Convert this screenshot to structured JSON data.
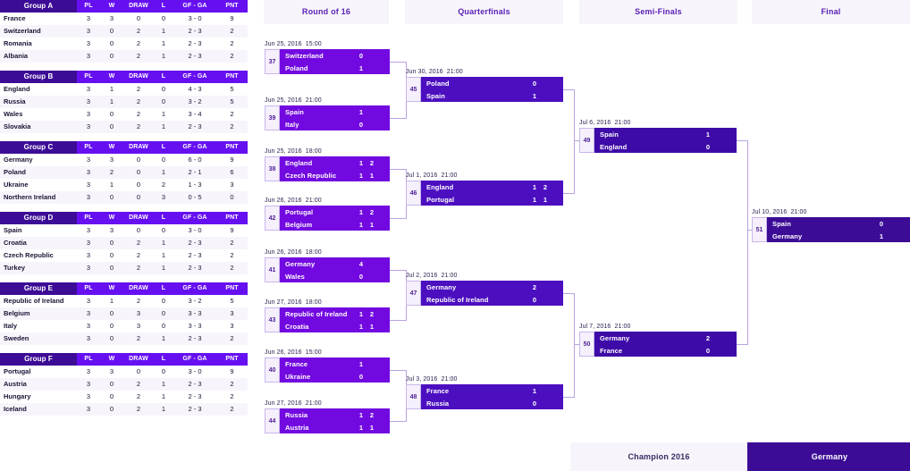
{
  "groups": {
    "columns": [
      "PL",
      "W",
      "DRAW",
      "L",
      "GF - GA",
      "PNT"
    ],
    "tables": [
      {
        "name": "Group A",
        "rows": [
          {
            "team": "France",
            "pl": "3",
            "w": "3",
            "draw": "0",
            "l": "0",
            "gfga": "3 - 0",
            "pnt": "9"
          },
          {
            "team": "Switzerland",
            "pl": "3",
            "w": "0",
            "draw": "2",
            "l": "1",
            "gfga": "2 - 3",
            "pnt": "2"
          },
          {
            "team": "Romania",
            "pl": "3",
            "w": "0",
            "draw": "2",
            "l": "1",
            "gfga": "2 - 3",
            "pnt": "2"
          },
          {
            "team": "Albania",
            "pl": "3",
            "w": "0",
            "draw": "2",
            "l": "1",
            "gfga": "2 - 3",
            "pnt": "2"
          }
        ]
      },
      {
        "name": "Group B",
        "rows": [
          {
            "team": "England",
            "pl": "3",
            "w": "1",
            "draw": "2",
            "l": "0",
            "gfga": "4 - 3",
            "pnt": "5"
          },
          {
            "team": "Russia",
            "pl": "3",
            "w": "1",
            "draw": "2",
            "l": "0",
            "gfga": "3 - 2",
            "pnt": "5"
          },
          {
            "team": "Wales",
            "pl": "3",
            "w": "0",
            "draw": "2",
            "l": "1",
            "gfga": "3 - 4",
            "pnt": "2"
          },
          {
            "team": "Slovakia",
            "pl": "3",
            "w": "0",
            "draw": "2",
            "l": "1",
            "gfga": "2 - 3",
            "pnt": "2"
          }
        ]
      },
      {
        "name": "Group C",
        "rows": [
          {
            "team": "Germany",
            "pl": "3",
            "w": "3",
            "draw": "0",
            "l": "0",
            "gfga": "6 - 0",
            "pnt": "9"
          },
          {
            "team": "Poland",
            "pl": "3",
            "w": "2",
            "draw": "0",
            "l": "1",
            "gfga": "2 - 1",
            "pnt": "6"
          },
          {
            "team": "Ukraine",
            "pl": "3",
            "w": "1",
            "draw": "0",
            "l": "2",
            "gfga": "1 - 3",
            "pnt": "3"
          },
          {
            "team": "Northern Ireland",
            "pl": "3",
            "w": "0",
            "draw": "0",
            "l": "3",
            "gfga": "0 - 5",
            "pnt": "0"
          }
        ]
      },
      {
        "name": "Group D",
        "rows": [
          {
            "team": "Spain",
            "pl": "3",
            "w": "3",
            "draw": "0",
            "l": "0",
            "gfga": "3 - 0",
            "pnt": "9"
          },
          {
            "team": "Croatia",
            "pl": "3",
            "w": "0",
            "draw": "2",
            "l": "1",
            "gfga": "2 - 3",
            "pnt": "2"
          },
          {
            "team": "Czech Republic",
            "pl": "3",
            "w": "0",
            "draw": "2",
            "l": "1",
            "gfga": "2 - 3",
            "pnt": "2"
          },
          {
            "team": "Turkey",
            "pl": "3",
            "w": "0",
            "draw": "2",
            "l": "1",
            "gfga": "2 - 3",
            "pnt": "2"
          }
        ]
      },
      {
        "name": "Group E",
        "rows": [
          {
            "team": "Republic of Ireland",
            "pl": "3",
            "w": "1",
            "draw": "2",
            "l": "0",
            "gfga": "3 - 2",
            "pnt": "5"
          },
          {
            "team": "Belgium",
            "pl": "3",
            "w": "0",
            "draw": "3",
            "l": "0",
            "gfga": "3 - 3",
            "pnt": "3"
          },
          {
            "team": "Italy",
            "pl": "3",
            "w": "0",
            "draw": "3",
            "l": "0",
            "gfga": "3 - 3",
            "pnt": "3"
          },
          {
            "team": "Sweden",
            "pl": "3",
            "w": "0",
            "draw": "2",
            "l": "1",
            "gfga": "2 - 3",
            "pnt": "2"
          }
        ]
      },
      {
        "name": "Group F",
        "rows": [
          {
            "team": "Portugal",
            "pl": "3",
            "w": "3",
            "draw": "0",
            "l": "0",
            "gfga": "3 - 0",
            "pnt": "9"
          },
          {
            "team": "Austria",
            "pl": "3",
            "w": "0",
            "draw": "2",
            "l": "1",
            "gfga": "2 - 3",
            "pnt": "2"
          },
          {
            "team": "Hungary",
            "pl": "3",
            "w": "0",
            "draw": "2",
            "l": "1",
            "gfga": "2 - 3",
            "pnt": "2"
          },
          {
            "team": "Iceland",
            "pl": "3",
            "w": "0",
            "draw": "2",
            "l": "1",
            "gfga": "2 - 3",
            "pnt": "2"
          }
        ]
      }
    ]
  },
  "rounds": [
    {
      "id": "round-of-16",
      "label": "Round of 16"
    },
    {
      "id": "quarterfinals",
      "label": "Quarterfinals"
    },
    {
      "id": "semi-finals",
      "label": "Semi-Finals"
    },
    {
      "id": "final",
      "label": "Final"
    }
  ],
  "matches": {
    "r16": [
      {
        "num": "37",
        "date": "Jun 25, 2016",
        "time": "15:00",
        "home": "Switzerland",
        "home_score": "0",
        "home_pen": "",
        "away": "Poland",
        "away_score": "1",
        "away_pen": ""
      },
      {
        "num": "39",
        "date": "Jun 25, 2016",
        "time": "21:00",
        "home": "Spain",
        "home_score": "1",
        "home_pen": "",
        "away": "Italy",
        "away_score": "0",
        "away_pen": ""
      },
      {
        "num": "38",
        "date": "Jun 25, 2016",
        "time": "18:00",
        "home": "England",
        "home_score": "1",
        "home_pen": "2",
        "away": "Czech Republic",
        "away_score": "1",
        "away_pen": "1"
      },
      {
        "num": "42",
        "date": "Jun 26, 2016",
        "time": "21:00",
        "home": "Portugal",
        "home_score": "1",
        "home_pen": "2",
        "away": "Belgium",
        "away_score": "1",
        "away_pen": "1"
      },
      {
        "num": "41",
        "date": "Jun 26, 2016",
        "time": "18:00",
        "home": "Germany",
        "home_score": "4",
        "home_pen": "",
        "away": "Wales",
        "away_score": "0",
        "away_pen": ""
      },
      {
        "num": "43",
        "date": "Jun 27, 2016",
        "time": "18:00",
        "home": "Republic of Ireland",
        "home_score": "1",
        "home_pen": "2",
        "away": "Croatia",
        "away_score": "1",
        "away_pen": "1"
      },
      {
        "num": "40",
        "date": "Jun 26, 2016",
        "time": "15:00",
        "home": "France",
        "home_score": "1",
        "home_pen": "",
        "away": "Ukraine",
        "away_score": "0",
        "away_pen": ""
      },
      {
        "num": "44",
        "date": "Jun 27, 2016",
        "time": "21:00",
        "home": "Russia",
        "home_score": "1",
        "home_pen": "2",
        "away": "Austria",
        "away_score": "1",
        "away_pen": "1"
      }
    ],
    "qf": [
      {
        "num": "45",
        "date": "Jun 30, 2016",
        "time": "21:00",
        "home": "Poland",
        "home_score": "0",
        "home_pen": "",
        "away": "Spain",
        "away_score": "1",
        "away_pen": ""
      },
      {
        "num": "46",
        "date": "Jul 1, 2016",
        "time": "21:00",
        "home": "England",
        "home_score": "1",
        "home_pen": "2",
        "away": "Portugal",
        "away_score": "1",
        "away_pen": "1"
      },
      {
        "num": "47",
        "date": "Jul 2, 2016",
        "time": "21:00",
        "home": "Germany",
        "home_score": "2",
        "home_pen": "",
        "away": "Republic of Ireland",
        "away_score": "0",
        "away_pen": ""
      },
      {
        "num": "48",
        "date": "Jul 3, 2016",
        "time": "21:00",
        "home": "France",
        "home_score": "1",
        "home_pen": "",
        "away": "Russia",
        "away_score": "0",
        "away_pen": ""
      }
    ],
    "sf": [
      {
        "num": "49",
        "date": "Jul 6, 2016",
        "time": "21:00",
        "home": "Spain",
        "home_score": "1",
        "home_pen": "",
        "away": "England",
        "away_score": "0",
        "away_pen": ""
      },
      {
        "num": "50",
        "date": "Jul 7, 2016",
        "time": "21:00",
        "home": "Germany",
        "home_score": "2",
        "home_pen": "",
        "away": "France",
        "away_score": "0",
        "away_pen": ""
      }
    ],
    "final": [
      {
        "num": "51",
        "date": "Jul 10, 2016",
        "time": "21:00",
        "home": "Spain",
        "home_score": "0",
        "home_pen": "",
        "away": "Germany",
        "away_score": "1",
        "away_pen": ""
      }
    ]
  },
  "champion": {
    "label": "Champion 2016",
    "team": "Germany"
  },
  "colors": {
    "round_of_16_box": "#7209e0",
    "quarterfinal_box": "#4c0fc0",
    "semifinal_box": "#3e0ba8",
    "final_box": "#3c0c96",
    "group_header_name": "#3c0c96",
    "group_header_cols": "#6610f2",
    "round_header_bg": "#f7f5fb",
    "round_header_text": "#5b21b6",
    "connector": "#b9a3e3"
  }
}
